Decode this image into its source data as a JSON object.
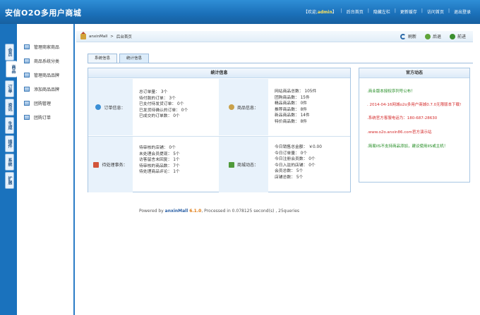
{
  "header": {
    "title": "安信O2O多用户商城",
    "welcome_prefix": "【欢迎,",
    "username": "admin",
    "welcome_suffix": "】",
    "nav": [
      "后台首页",
      "隐藏左栏",
      "更新缓存",
      "访问首页",
      "退出登录"
    ]
  },
  "rail": {
    "tabs": [
      "会员",
      "商品",
      "订单",
      "资讯",
      "生成",
      "插件",
      "系统",
      "扩展"
    ],
    "active": "商品"
  },
  "sidebar": {
    "items": [
      "管理商家商品",
      "商品系统分类",
      "管理商品品牌",
      "添加商品品牌",
      "团购管理",
      "团购订单"
    ]
  },
  "breadcrumb": {
    "site": "anxinMall",
    "sep": ">",
    "current": "后台首页"
  },
  "tools": {
    "refresh": "刷新",
    "back": "后退",
    "forward": "前进"
  },
  "tabs": [
    "系统信息",
    "统计信息"
  ],
  "stats": {
    "title": "统计信息",
    "order_label": "订单信息：",
    "order_lines": [
      "总订单量： 3个",
      "待付款的订单： 3个",
      "已支付待发货订单： 0个",
      "已发货待确认的订单： 0个",
      "已成交的订单数： 0个"
    ],
    "goods_label": "商品信息：",
    "goods_lines": [
      "网站商品总数： 105件",
      "团购商品数： 15件",
      "精品商品数： 0件",
      "推荐商品数： 8件",
      "新品商品数： 14件",
      "特价商品数： 8件"
    ],
    "pending_label": "待处理事务：",
    "pending_lines": [
      "待审核的店铺： 0个",
      "未处理会员提现： 5个",
      "访客留言未回复： 1个",
      "待审核的商品数： 7个",
      "待处理商品评论： 1个"
    ],
    "dynamic_label": "商城动态：",
    "dynamic_lines": [
      "今日销售总金额： ￥0.00",
      "今日订单量： 0个",
      "今日注册会员数： 0个",
      "今日入驻的店铺： 0个",
      "会员总数： 5个",
      "店铺总数： 5个"
    ]
  },
  "news": {
    "title": "官方动态",
    "items": [
      {
        "text": ".商业版本授权序列号公布！",
        "color": "green"
      },
      {
        "text": ". 2014-04-16网城o2o多用户商城0.7.0无限版本下载!",
        "color": "red"
      },
      {
        "text": ".系统官方客服电话为：180-687-28630",
        "color": "red"
      },
      {
        "text": ".www.o2o.anxin86.com官方演示站",
        "color": "red"
      },
      {
        "text": ".简易IIS不支持商品添加，建议使用IIS或主机！",
        "color": "green"
      }
    ]
  },
  "footer": {
    "prefix": "Powered by ",
    "brand": "anxinMall",
    "version": "6.1.0",
    "suffix": ", Processed in 0.078125 second(s) , 25queries"
  }
}
